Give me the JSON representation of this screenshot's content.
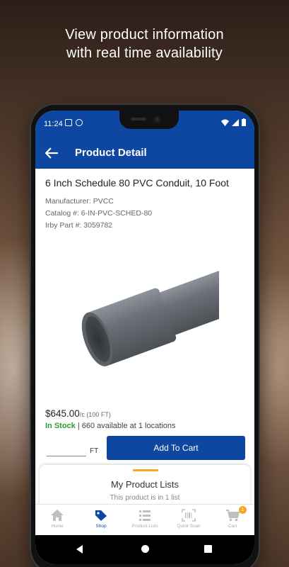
{
  "promo": {
    "line1": "View product information",
    "line2": "with real time availability"
  },
  "status_bar": {
    "time": "11:24"
  },
  "app_bar": {
    "title": "Product Detail",
    "back_icon": "arrow-left-icon"
  },
  "product": {
    "title": "6 Inch Schedule 80 PVC Conduit, 10 Foot",
    "manufacturer": "Manufacturer: PVCC",
    "catalog": "Catalog #: 6-IN-PVC-SCHED-80",
    "irby_part": "Irby Part #: 3059782",
    "price": "$645.00",
    "price_unit": "/c (100 FT)",
    "stock_status": "In Stock",
    "availability": "| 660 available at 1 locations",
    "qty_value": "",
    "qty_unit": "FT",
    "add_to_cart": "Add To Cart"
  },
  "lists_sheet": {
    "title": "My Product Lists",
    "subtitle": "This product is in 1 list"
  },
  "bottom_nav": {
    "items": [
      {
        "label": "Home",
        "icon": "home-icon"
      },
      {
        "label": "Shop",
        "icon": "tag-icon"
      },
      {
        "label": "Product Lists",
        "icon": "list-icon"
      },
      {
        "label": "Quick Scan",
        "icon": "barcode-icon"
      },
      {
        "label": "Cart",
        "icon": "cart-icon"
      }
    ],
    "active": "Shop",
    "cart_count": "1"
  },
  "colors": {
    "brand": "#0d47a1",
    "in_stock": "#2e9b35",
    "accent": "#f5a623"
  }
}
